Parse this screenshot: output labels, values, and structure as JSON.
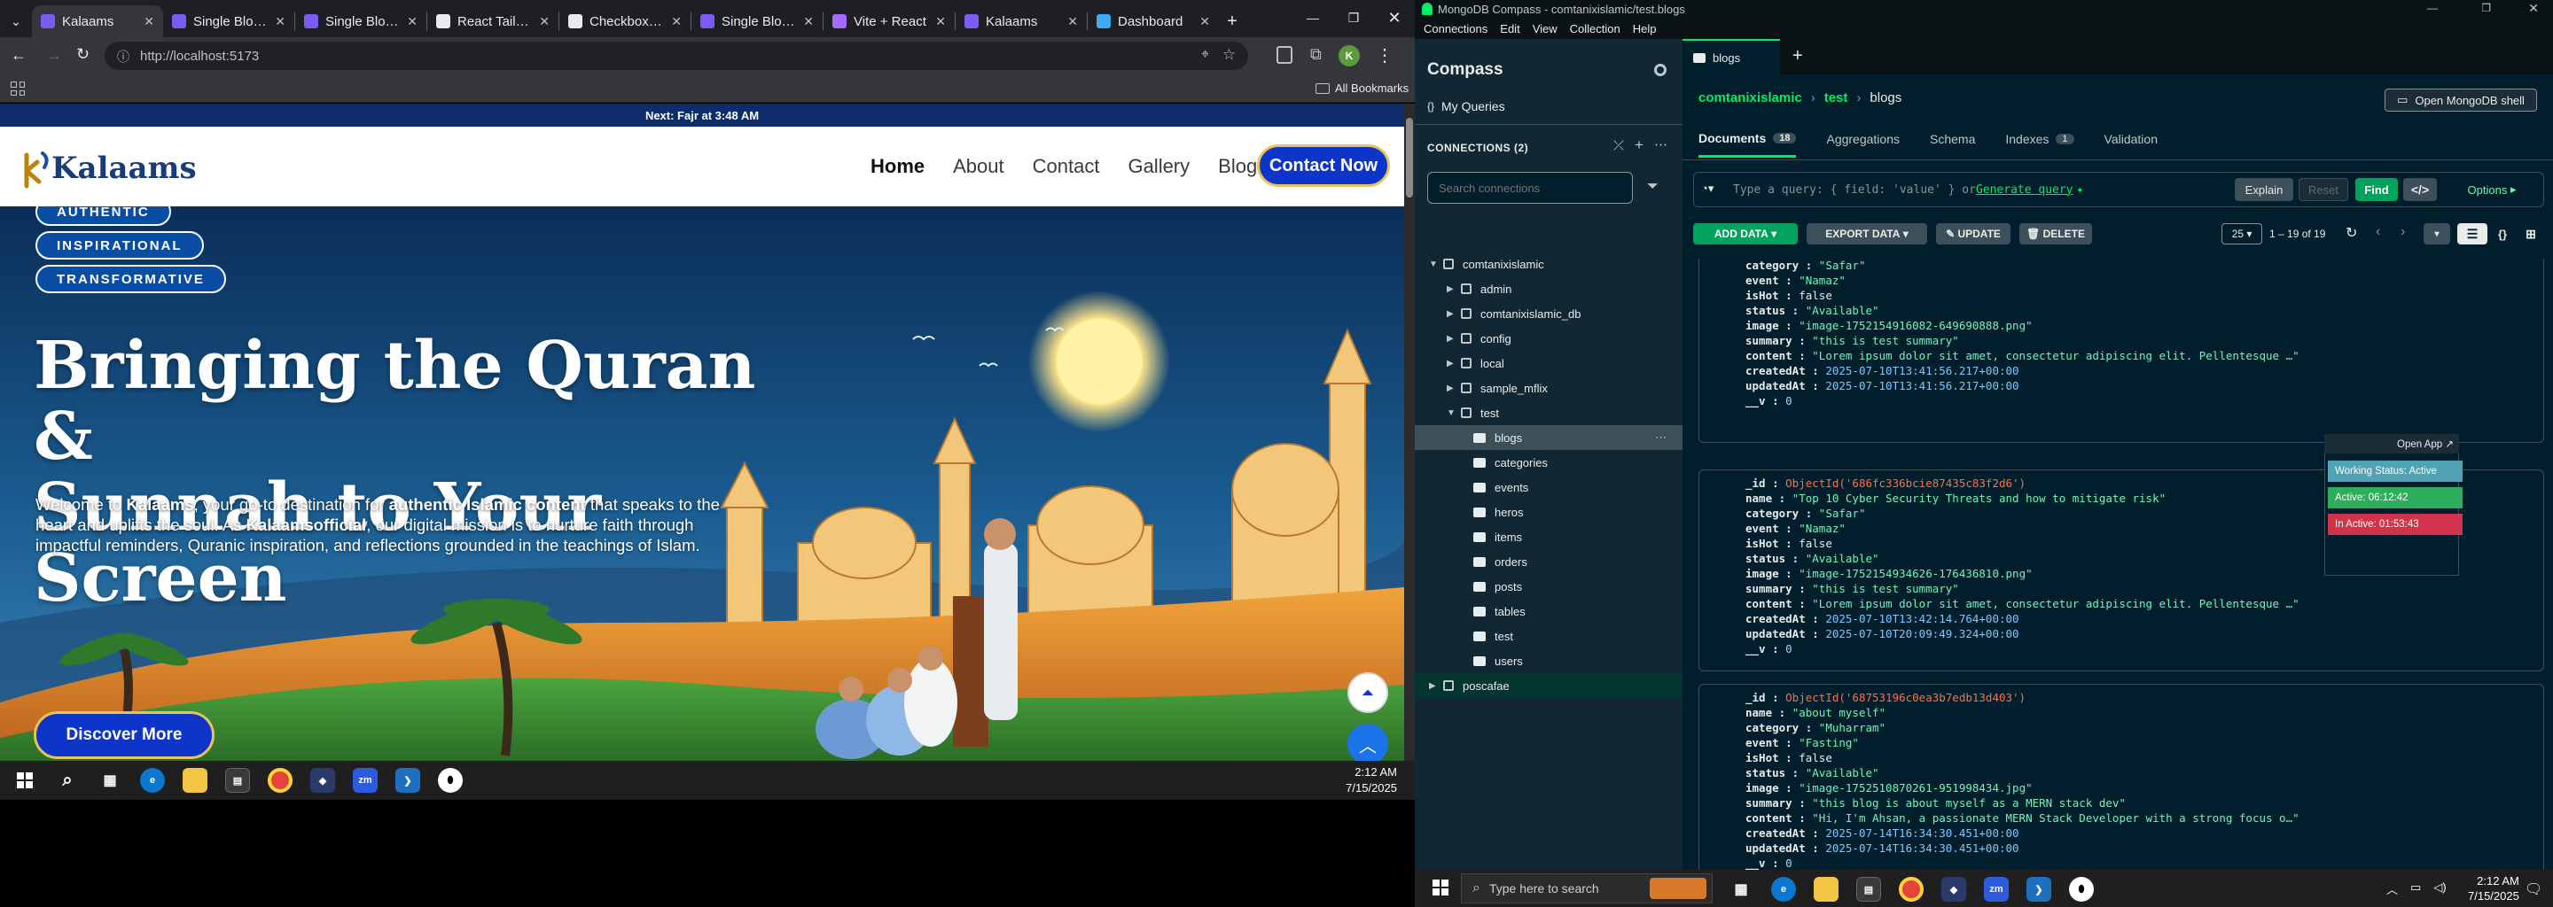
{
  "browser": {
    "tabs": [
      {
        "title": "Kalaams",
        "active": true,
        "favicon_color": "#7b5cf0"
      },
      {
        "title": "Single Blog Po",
        "favicon_color": "#7b5cf0"
      },
      {
        "title": "Single Blog Po",
        "favicon_color": "#7b5cf0"
      },
      {
        "title": "React Tailwind",
        "favicon_color": "#e8eaed"
      },
      {
        "title": "Checkboxes in",
        "favicon_color": "#e8eaed"
      },
      {
        "title": "Single Blog Po",
        "favicon_color": "#7b5cf0"
      },
      {
        "title": "Vite + React",
        "favicon_color": "#a36bff"
      },
      {
        "title": "Kalaams",
        "favicon_color": "#7b5cf0"
      },
      {
        "title": "Dashboard",
        "favicon_color": "#3fa9f5"
      }
    ],
    "url": "http://localhost:5173",
    "all_bookmarks": "All Bookmarks",
    "profile_initial": "K"
  },
  "site": {
    "prayer_bar": "Next: Fajr at 3:48 AM",
    "logo_text": "Kalaams",
    "nav": [
      "Home",
      "About",
      "Contact",
      "Gallery",
      "Blogs"
    ],
    "contact_button": "Contact Now",
    "chips": [
      "AUTHENTIC",
      "INSPIRATIONAL",
      "TRANSFORMATIVE"
    ],
    "hero_title_line1": "Bringing the Quran &",
    "hero_title_line2": "Sunnah to Your Screen",
    "hero_p": {
      "a": "Welcome to ",
      "b": "Kalaams",
      "c": ", your go-to destination for ",
      "d": "authentic Islamic content",
      "e": " that speaks to the heart and uplifts the soul. As ",
      "f": "Kalaamsofficial",
      "g": ", our digital mission is to nurture faith through impactful reminders, Quranic inspiration, and reflections grounded in the teachings of Islam."
    },
    "discover_button": "Discover More"
  },
  "taskbar_left": {
    "time": "2:12 AM",
    "date": "7/15/2025",
    "zm": "zm"
  },
  "compass": {
    "window_title": "MongoDB Compass - comtanixislamic/test.blogs",
    "menu": [
      "Connections",
      "Edit",
      "View",
      "Collection",
      "Help"
    ],
    "app_name": "Compass",
    "my_queries": "My Queries",
    "connections_label": "CONNECTIONS (2)",
    "search_placeholder": "Search connections",
    "tree": {
      "cluster": "comtanixislamic",
      "dbs": [
        "admin",
        "comtanixislamic_db",
        "config",
        "local",
        "sample_mflix",
        "test"
      ],
      "collections": [
        "blogs",
        "categories",
        "events",
        "heros",
        "items",
        "orders",
        "posts",
        "tables",
        "test",
        "users"
      ],
      "second_cluster": "poscafae"
    },
    "tab": "blogs",
    "breadcrumb": [
      "comtanixislamic",
      "test",
      "blogs"
    ],
    "open_shell": "Open MongoDB shell",
    "subtabs": [
      {
        "label": "Documents",
        "count": "18"
      },
      {
        "label": "Aggregations"
      },
      {
        "label": "Schema"
      },
      {
        "label": "Indexes",
        "count": "1"
      },
      {
        "label": "Validation"
      }
    ],
    "query_placeholder": "Type a query: { field: 'value' } or ",
    "generate_query": "Generate query",
    "query_buttons": {
      "explain": "Explain",
      "reset": "Reset",
      "find": "Find",
      "options": "Options"
    },
    "toolbar": {
      "add": "ADD DATA",
      "export": "EXPORT DATA",
      "update": "UPDATE",
      "delete": "DELETE",
      "per_page": "25",
      "range": "1 – 19 of 19"
    },
    "docs": [
      {
        "partial": true,
        "fields": [
          [
            "category",
            "\"Safar\"",
            "s"
          ],
          [
            "event",
            "\"Namaz\"",
            "s"
          ],
          [
            "isHot",
            "false",
            "k2"
          ],
          [
            "status",
            "\"Available\"",
            "s"
          ],
          [
            "image",
            "\"image-1752154916082-649690888.png\"",
            "s"
          ],
          [
            "summary",
            "\"this is test summary\"",
            "s"
          ],
          [
            "content",
            "\"Lorem ipsum dolor sit amet, consectetur adipiscing elit. Pellentesque …\"",
            "s"
          ],
          [
            "createdAt",
            "2025-07-10T13:41:56.217+00:00",
            "ts"
          ],
          [
            "updatedAt",
            "2025-07-10T13:41:56.217+00:00",
            "ts"
          ],
          [
            "__v",
            "0",
            "n"
          ]
        ]
      },
      {
        "fields": [
          [
            "_id",
            "ObjectId('686fc336bcie87435c83f2d6')",
            "o"
          ],
          [
            "name",
            "\"Top 10 Cyber Security Threats and how to mitigate risk\"",
            "s"
          ],
          [
            "category",
            "\"Safar\"",
            "s"
          ],
          [
            "event",
            "\"Namaz\"",
            "s"
          ],
          [
            "isHot",
            "false",
            "k2"
          ],
          [
            "status",
            "\"Available\"",
            "s"
          ],
          [
            "image",
            "\"image-1752154934626-176436810.png\"",
            "s"
          ],
          [
            "summary",
            "\"this is test summary\"",
            "s"
          ],
          [
            "content",
            "\"Lorem ipsum dolor sit amet, consectetur adipiscing elit. Pellentesque …\"",
            "s"
          ],
          [
            "createdAt",
            "2025-07-10T13:42:14.764+00:00",
            "ts"
          ],
          [
            "updatedAt",
            "2025-07-10T20:09:49.324+00:00",
            "ts"
          ],
          [
            "__v",
            "0",
            "n"
          ]
        ]
      },
      {
        "fields": [
          [
            "_id",
            "ObjectId('68753196c0ea3b7edb13d403')",
            "o"
          ],
          [
            "name",
            "\"about myself\"",
            "s"
          ],
          [
            "category",
            "\"Muharram\"",
            "s"
          ],
          [
            "event",
            "\"Fasting\"",
            "s"
          ],
          [
            "isHot",
            "false",
            "k2"
          ],
          [
            "status",
            "\"Available\"",
            "s"
          ],
          [
            "image",
            "\"image-1752510870261-951998434.jpg\"",
            "s"
          ],
          [
            "summary",
            "\"this blog is about myself as a MERN stack dev\"",
            "s"
          ],
          [
            "content",
            "\"Hi, I'm Ahsan, a passionate MERN Stack Developer with a strong focus o…\"",
            "s"
          ],
          [
            "createdAt",
            "2025-07-14T16:34:30.451+00:00",
            "ts"
          ],
          [
            "updatedAt",
            "2025-07-14T16:34:30.451+00:00",
            "ts"
          ],
          [
            "__v",
            "0",
            "n"
          ]
        ]
      }
    ],
    "overlay": {
      "open_app": "Open App ↗",
      "working": "Working Status: Active",
      "active": "Active: 06:12:42",
      "inactive": "In Active: 01:53:43"
    }
  },
  "taskbar_right": {
    "search_placeholder": "Type here to search",
    "time": "2:12 AM",
    "date": "7/15/2025",
    "zm": "zm"
  },
  "colors": {
    "compass_bg": "#001e2b",
    "compass_green": "#00ed64",
    "site_blue": "#0d35c9"
  }
}
